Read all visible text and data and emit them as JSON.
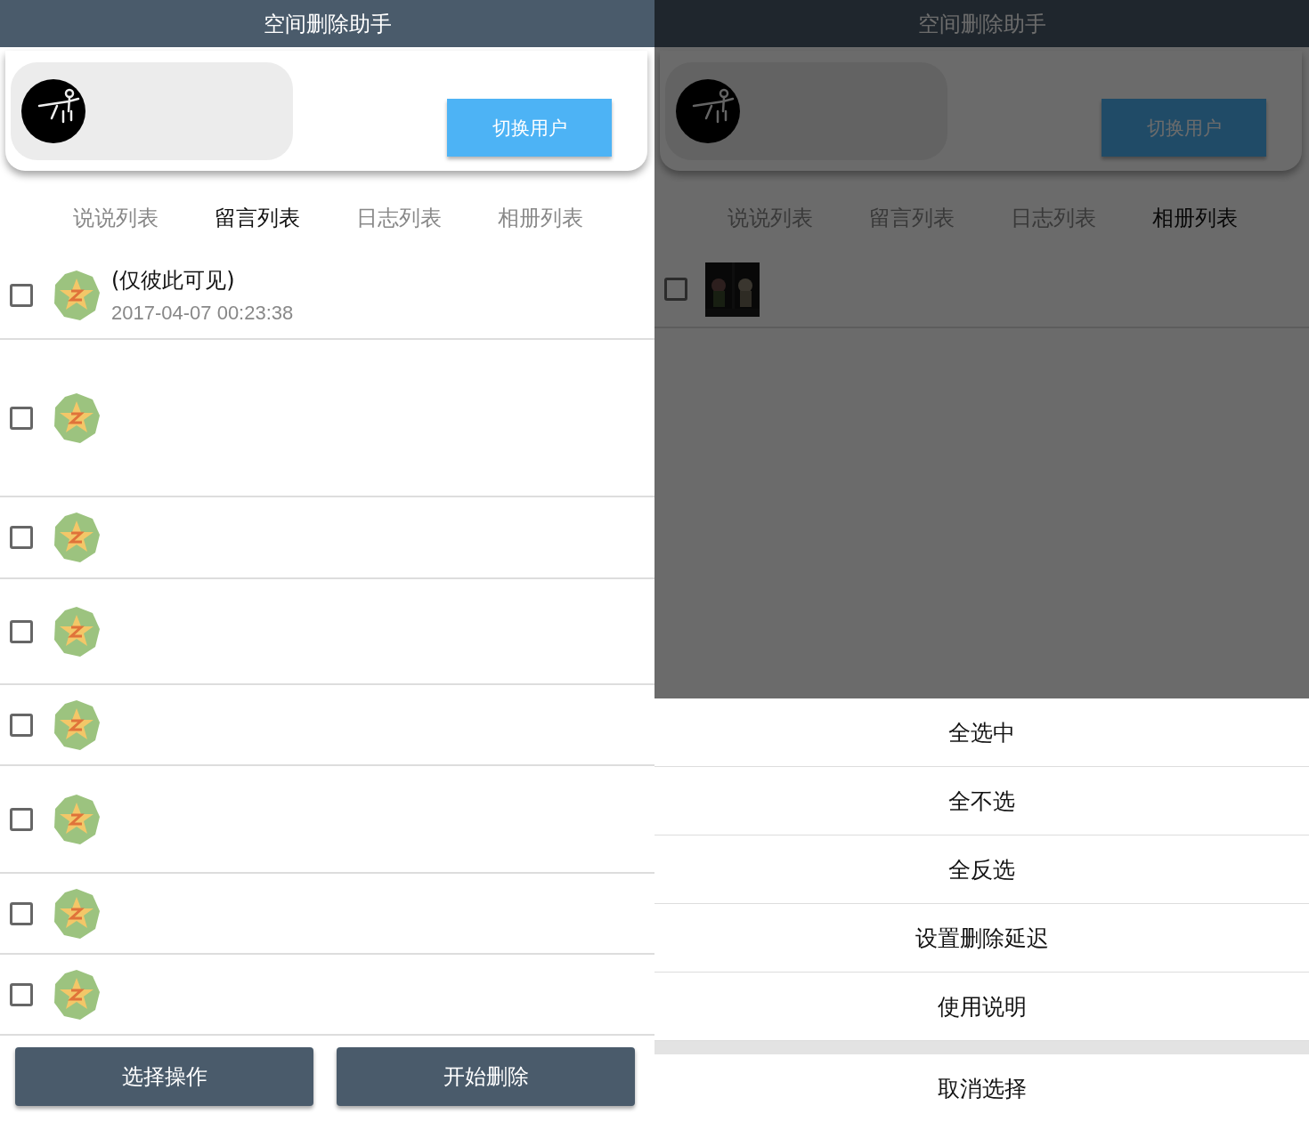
{
  "left": {
    "title": "空间删除助手",
    "switch_button": "切换用户",
    "tabs": [
      {
        "label": "说说列表",
        "selected": false
      },
      {
        "label": "留言列表",
        "selected": true
      },
      {
        "label": "日志列表",
        "selected": false
      },
      {
        "label": "相册列表",
        "selected": false
      }
    ],
    "rows": [
      {
        "checked": false,
        "title": "(仅彼此可见)",
        "time": "2017-04-07 00:23:38"
      },
      {
        "checked": false
      },
      {
        "checked": false
      },
      {
        "checked": false
      },
      {
        "checked": false
      },
      {
        "checked": false
      },
      {
        "checked": false
      },
      {
        "checked": false
      }
    ],
    "buttons": [
      "选择操作",
      "开始删除"
    ]
  },
  "right": {
    "title": "空间删除助手",
    "switch_button": "切换用户",
    "tabs": [
      {
        "label": "说说列表",
        "selected": false
      },
      {
        "label": "留言列表",
        "selected": false
      },
      {
        "label": "日志列表",
        "selected": false
      },
      {
        "label": "相册列表",
        "selected": true
      }
    ],
    "action_sheet": {
      "items": [
        "全选中",
        "全不选",
        "全反选",
        "设置删除延迟",
        "使用说明"
      ],
      "cancel": "取消选择"
    }
  }
}
